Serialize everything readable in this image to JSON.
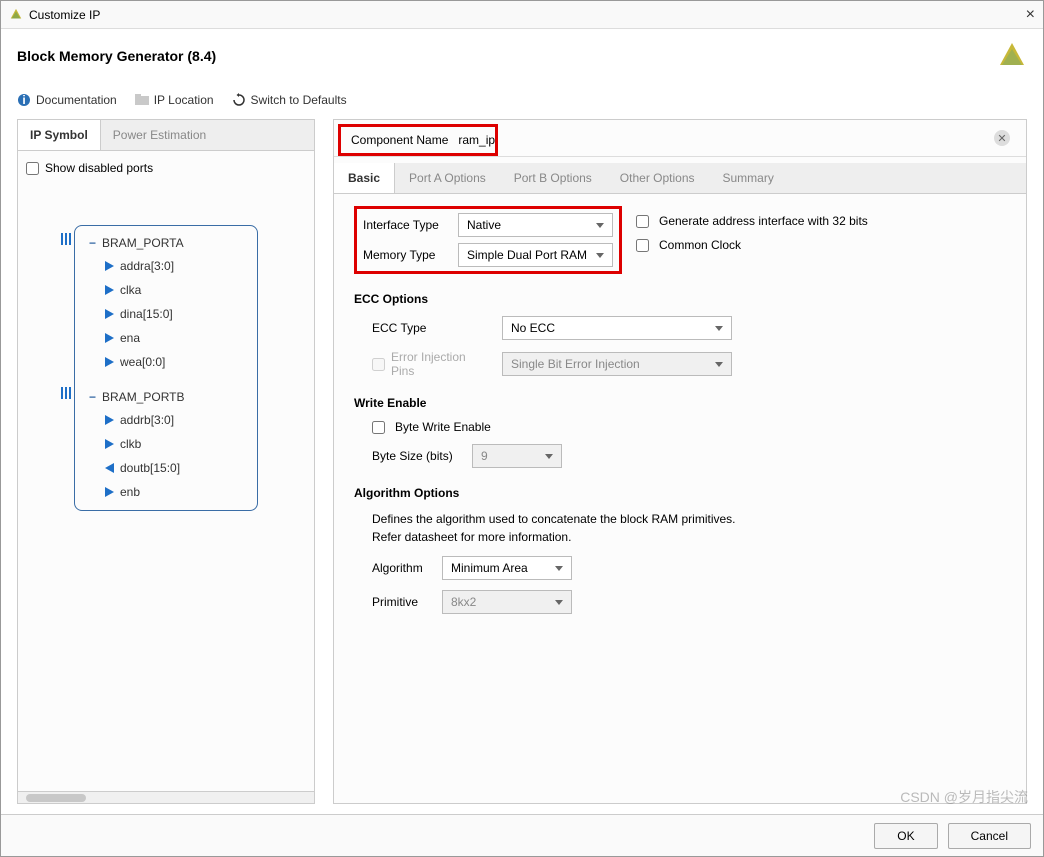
{
  "window": {
    "title": "Customize IP"
  },
  "header": {
    "title": "Block Memory Generator (8.4)"
  },
  "toolbar": {
    "documentation": "Documentation",
    "ip_location": "IP Location",
    "switch_defaults": "Switch to Defaults"
  },
  "left": {
    "tabs": [
      "IP Symbol",
      "Power Estimation"
    ],
    "active_tab": 0,
    "show_disabled_label": "Show disabled ports",
    "ports": {
      "groupA": "BRAM_PORTA",
      "groupB": "BRAM_PORTB",
      "A": [
        "addra[3:0]",
        "clka",
        "dina[15:0]",
        "ena",
        "wea[0:0]"
      ],
      "B_in": [
        "addrb[3:0]",
        "clkb"
      ],
      "B_out": [
        "doutb[15:0]"
      ],
      "B_in2": [
        "enb"
      ]
    }
  },
  "component_name": {
    "label": "Component Name",
    "value": "ram_ip"
  },
  "main_tabs": [
    "Basic",
    "Port A Options",
    "Port B Options",
    "Other Options",
    "Summary"
  ],
  "basic": {
    "interface_type": {
      "label": "Interface Type",
      "value": "Native"
    },
    "memory_type": {
      "label": "Memory Type",
      "value": "Simple Dual Port RAM"
    },
    "gen_addr32_label": "Generate address interface with 32 bits",
    "common_clock_label": "Common Clock",
    "ecc": {
      "title": "ECC Options",
      "ecc_type": {
        "label": "ECC Type",
        "value": "No ECC"
      },
      "err_inj_label": "Error Injection Pins",
      "err_inj_value": "Single Bit Error Injection"
    },
    "write_enable": {
      "title": "Write Enable",
      "byte_we_label": "Byte Write Enable",
      "byte_size_label": "Byte Size (bits)",
      "byte_size_value": "9"
    },
    "algo": {
      "title": "Algorithm Options",
      "desc1": "Defines the algorithm used to concatenate the block RAM primitives.",
      "desc2": "Refer datasheet for more information.",
      "algorithm": {
        "label": "Algorithm",
        "value": "Minimum Area"
      },
      "primitive": {
        "label": "Primitive",
        "value": "8kx2"
      }
    }
  },
  "footer": {
    "ok": "OK",
    "cancel": "Cancel"
  },
  "watermark": "CSDN @岁月指尖流"
}
